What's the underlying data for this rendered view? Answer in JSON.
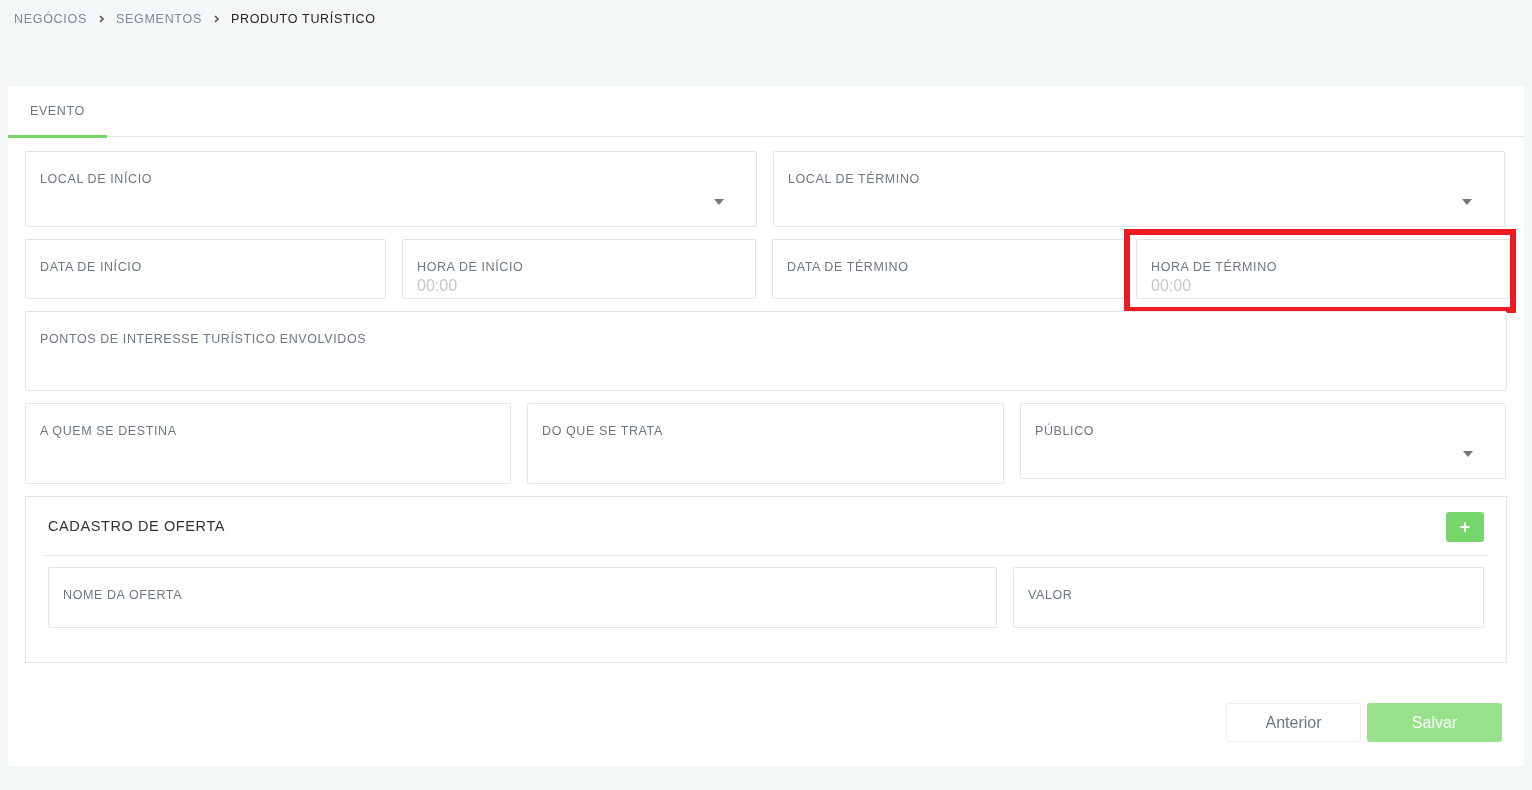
{
  "breadcrumb": [
    {
      "label": "NEGÓCIOS",
      "current": false
    },
    {
      "label": "SEGMENTOS",
      "current": false
    },
    {
      "label": "PRODUTO TURÍSTICO",
      "current": true
    }
  ],
  "tabs": [
    {
      "label": "EVENTO",
      "selected": true
    }
  ],
  "form": {
    "rows": [
      [
        {
          "label": "LOCAL DE INÍCIO",
          "kind": "select",
          "highlighted": false
        },
        {
          "label": "LOCAL DE TÉRMINO",
          "kind": "select",
          "highlighted": false
        }
      ],
      [
        {
          "label": "DATA DE INÍCIO",
          "kind": "text",
          "highlighted": false
        },
        {
          "label": "HORA DE INÍCIO",
          "kind": "text",
          "placeholder": "00:00",
          "highlighted": false
        },
        {
          "label": "DATA DE TÉRMINO",
          "kind": "text",
          "highlighted": false
        },
        {
          "label": "HORA DE TÉRMINO",
          "kind": "text",
          "placeholder": "00:00",
          "highlighted": true
        }
      ],
      [
        {
          "label": "PONTOS DE INTERESSE TURÍSTICO ENVOLVIDOS",
          "kind": "text",
          "highlighted": false
        }
      ],
      [
        {
          "label": "A QUEM SE DESTINA",
          "kind": "text",
          "highlighted": false
        },
        {
          "label": "DO QUE SE TRATA",
          "kind": "text",
          "highlighted": false
        },
        {
          "label": "PÚBLICO",
          "kind": "select",
          "highlighted": false
        }
      ]
    ]
  },
  "offer_section": {
    "title": "CADASTRO DE OFERTA",
    "add_button": "+",
    "fields": [
      {
        "label": "NOME DA OFERTA",
        "kind": "text",
        "highlighted": false
      },
      {
        "label": "VALOR",
        "kind": "text",
        "highlighted": false
      }
    ]
  },
  "buttons": [
    {
      "label": "Anterior",
      "kind": "secondary",
      "disabled": false
    },
    {
      "label": "Salvar",
      "kind": "primary",
      "disabled": true
    }
  ]
}
